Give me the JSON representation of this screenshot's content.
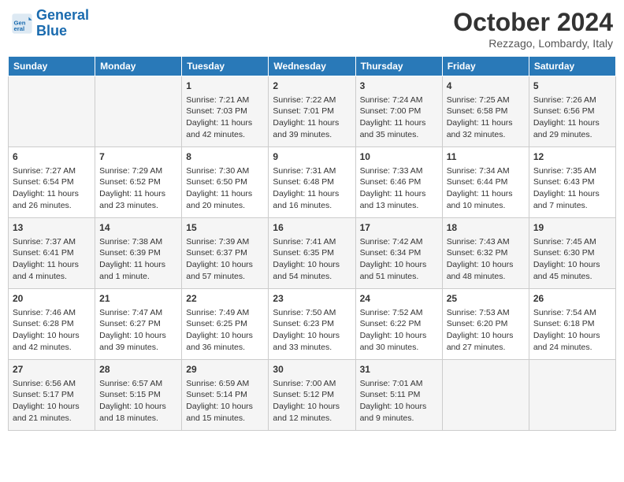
{
  "header": {
    "logo_line1": "General",
    "logo_line2": "Blue",
    "month_year": "October 2024",
    "location": "Rezzago, Lombardy, Italy"
  },
  "days_of_week": [
    "Sunday",
    "Monday",
    "Tuesday",
    "Wednesday",
    "Thursday",
    "Friday",
    "Saturday"
  ],
  "weeks": [
    [
      {
        "day": "",
        "content": ""
      },
      {
        "day": "",
        "content": ""
      },
      {
        "day": "1",
        "content": "Sunrise: 7:21 AM\nSunset: 7:03 PM\nDaylight: 11 hours and 42 minutes."
      },
      {
        "day": "2",
        "content": "Sunrise: 7:22 AM\nSunset: 7:01 PM\nDaylight: 11 hours and 39 minutes."
      },
      {
        "day": "3",
        "content": "Sunrise: 7:24 AM\nSunset: 7:00 PM\nDaylight: 11 hours and 35 minutes."
      },
      {
        "day": "4",
        "content": "Sunrise: 7:25 AM\nSunset: 6:58 PM\nDaylight: 11 hours and 32 minutes."
      },
      {
        "day": "5",
        "content": "Sunrise: 7:26 AM\nSunset: 6:56 PM\nDaylight: 11 hours and 29 minutes."
      }
    ],
    [
      {
        "day": "6",
        "content": "Sunrise: 7:27 AM\nSunset: 6:54 PM\nDaylight: 11 hours and 26 minutes."
      },
      {
        "day": "7",
        "content": "Sunrise: 7:29 AM\nSunset: 6:52 PM\nDaylight: 11 hours and 23 minutes."
      },
      {
        "day": "8",
        "content": "Sunrise: 7:30 AM\nSunset: 6:50 PM\nDaylight: 11 hours and 20 minutes."
      },
      {
        "day": "9",
        "content": "Sunrise: 7:31 AM\nSunset: 6:48 PM\nDaylight: 11 hours and 16 minutes."
      },
      {
        "day": "10",
        "content": "Sunrise: 7:33 AM\nSunset: 6:46 PM\nDaylight: 11 hours and 13 minutes."
      },
      {
        "day": "11",
        "content": "Sunrise: 7:34 AM\nSunset: 6:44 PM\nDaylight: 11 hours and 10 minutes."
      },
      {
        "day": "12",
        "content": "Sunrise: 7:35 AM\nSunset: 6:43 PM\nDaylight: 11 hours and 7 minutes."
      }
    ],
    [
      {
        "day": "13",
        "content": "Sunrise: 7:37 AM\nSunset: 6:41 PM\nDaylight: 11 hours and 4 minutes."
      },
      {
        "day": "14",
        "content": "Sunrise: 7:38 AM\nSunset: 6:39 PM\nDaylight: 11 hours and 1 minute."
      },
      {
        "day": "15",
        "content": "Sunrise: 7:39 AM\nSunset: 6:37 PM\nDaylight: 10 hours and 57 minutes."
      },
      {
        "day": "16",
        "content": "Sunrise: 7:41 AM\nSunset: 6:35 PM\nDaylight: 10 hours and 54 minutes."
      },
      {
        "day": "17",
        "content": "Sunrise: 7:42 AM\nSunset: 6:34 PM\nDaylight: 10 hours and 51 minutes."
      },
      {
        "day": "18",
        "content": "Sunrise: 7:43 AM\nSunset: 6:32 PM\nDaylight: 10 hours and 48 minutes."
      },
      {
        "day": "19",
        "content": "Sunrise: 7:45 AM\nSunset: 6:30 PM\nDaylight: 10 hours and 45 minutes."
      }
    ],
    [
      {
        "day": "20",
        "content": "Sunrise: 7:46 AM\nSunset: 6:28 PM\nDaylight: 10 hours and 42 minutes."
      },
      {
        "day": "21",
        "content": "Sunrise: 7:47 AM\nSunset: 6:27 PM\nDaylight: 10 hours and 39 minutes."
      },
      {
        "day": "22",
        "content": "Sunrise: 7:49 AM\nSunset: 6:25 PM\nDaylight: 10 hours and 36 minutes."
      },
      {
        "day": "23",
        "content": "Sunrise: 7:50 AM\nSunset: 6:23 PM\nDaylight: 10 hours and 33 minutes."
      },
      {
        "day": "24",
        "content": "Sunrise: 7:52 AM\nSunset: 6:22 PM\nDaylight: 10 hours and 30 minutes."
      },
      {
        "day": "25",
        "content": "Sunrise: 7:53 AM\nSunset: 6:20 PM\nDaylight: 10 hours and 27 minutes."
      },
      {
        "day": "26",
        "content": "Sunrise: 7:54 AM\nSunset: 6:18 PM\nDaylight: 10 hours and 24 minutes."
      }
    ],
    [
      {
        "day": "27",
        "content": "Sunrise: 6:56 AM\nSunset: 5:17 PM\nDaylight: 10 hours and 21 minutes."
      },
      {
        "day": "28",
        "content": "Sunrise: 6:57 AM\nSunset: 5:15 PM\nDaylight: 10 hours and 18 minutes."
      },
      {
        "day": "29",
        "content": "Sunrise: 6:59 AM\nSunset: 5:14 PM\nDaylight: 10 hours and 15 minutes."
      },
      {
        "day": "30",
        "content": "Sunrise: 7:00 AM\nSunset: 5:12 PM\nDaylight: 10 hours and 12 minutes."
      },
      {
        "day": "31",
        "content": "Sunrise: 7:01 AM\nSunset: 5:11 PM\nDaylight: 10 hours and 9 minutes."
      },
      {
        "day": "",
        "content": ""
      },
      {
        "day": "",
        "content": ""
      }
    ]
  ]
}
